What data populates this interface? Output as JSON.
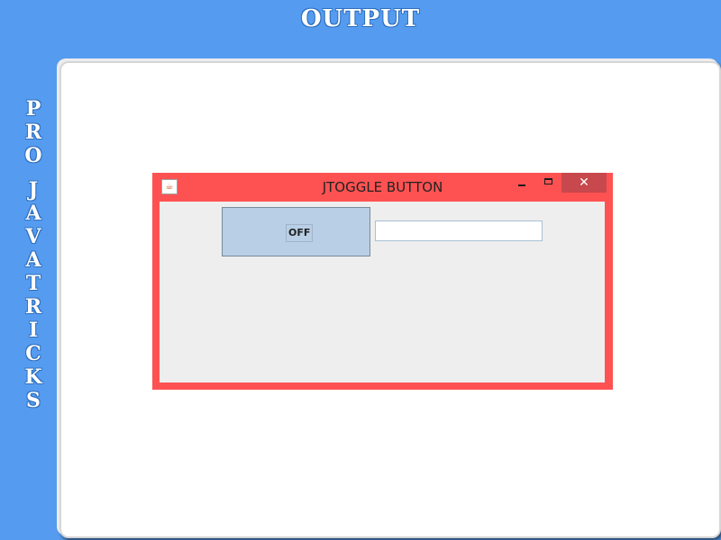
{
  "page": {
    "title": "OUTPUT",
    "side_letters": [
      "P",
      "R",
      "O",
      "",
      "J",
      "A",
      "V",
      "A",
      "T",
      "R",
      "I",
      "C",
      "K",
      "S"
    ],
    "background_color": "#559cf0"
  },
  "window": {
    "title": "JTOGGLE BUTTON",
    "frame_color": "#fe5252",
    "app_icon": "java-icon",
    "controls": {
      "close_glyph": "✕"
    },
    "toggle_button": {
      "label": "OFF",
      "selected": false
    },
    "text_field": {
      "value": ""
    }
  }
}
